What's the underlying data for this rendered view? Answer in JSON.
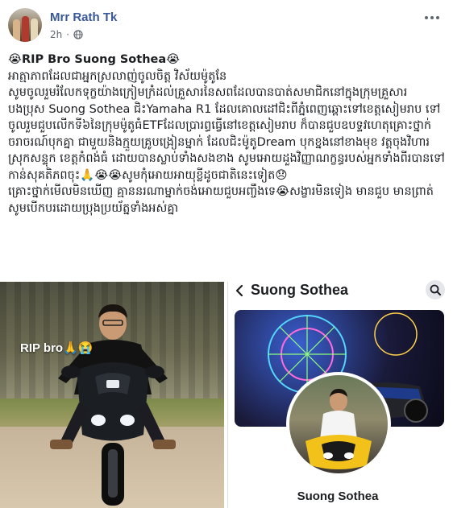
{
  "post": {
    "author": "Mrr Rath Tk",
    "time": "2h",
    "privacy_icon": "globe-icon",
    "title": "😭RIP Bro Suong Sothea😭",
    "paragraphs": [
      "អាត្មាភាពដែលជាអ្នកស្រលាញ់ចូលចិត្ត វិស័យម៉ូតូនែ",
      "សូមចូលរួមរំលែកទុក្ខយ៉ាងក្រៀមក្រំដល់គ្រួសារនៃសពដែលបានបាត់សមាជិកនៅក្នុងក្រុមគ្រួសារ",
      "បងប្រុស Suong Sothea ជិះYamaha R1 ដែលគោលដៅជិះពីភ្នំពេញឆ្ពោះទៅខេត្តសៀមរាប ទៅចូលរួមជួបលើកទី៦នៃក្រុមម៉ូតូធំETFដែលប្រារព្ធធ្វើនៅខេត្តសៀមរាប ក៏បានជួបឧបទ្ទវហេតុគ្រោះថ្នាក់ចរាចរណ៍បុកគ្នា ជាមួយនិងក្មួយគ្រូបង្រៀនម្នាក់ ដែលជិះម៉ូតូDream បុកខ្នងនៅខាងមុខ វត្តចុងវិហារ ស្រុកសន្ទុក ខេត្តកំពង់ធំ ដោយបានស្លាប់ទាំងសងខាង សូមអោយដួងវិញ្ញាណក្ខន្ធរបស់អ្នកទាំងពីរបានទៅកាន់សុគតិភពចុះ🙏😭😭សូមកុំអោយអាយុខ្លីដូចជាតិនេះទៀត😞",
      "គ្រោះថ្នាក់មើលមិនឃើញ គ្មាននរណាម្នាក់ចង់អោយជួបអញ្ចឹងទេ😭សង្ខារមិនទៀង មានជួប មានព្រាត់",
      "សូមបើកបរដោយប្រុងប្រយ័ត្នទាំងអស់គ្នា"
    ]
  },
  "photo_left": {
    "caption": "RIP bro🙏😭"
  },
  "profile_card": {
    "title": "Suong Sothea",
    "name": "Suong Sothea",
    "back_icon": "chevron-left-icon",
    "search_icon": "search-icon"
  },
  "colors": {
    "author_blue": "#385898",
    "text": "#1c1e21",
    "meta_gray": "#606770"
  }
}
